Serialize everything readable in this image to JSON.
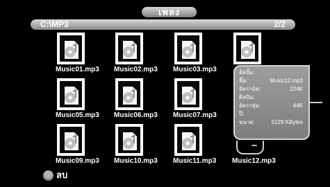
{
  "window": {
    "title": "เพลง"
  },
  "path_bar": {
    "path": "C:\\MP3",
    "page": "2/2"
  },
  "files": [
    "Music01.mp3",
    "Music02.mp3",
    "Music03.mp3",
    "Music05.mp3",
    "Music06.mp3",
    "Music07.mp3",
    "Music09.mp3",
    "Music10.mp3",
    "Music11.mp3",
    "Music12.mp3"
  ],
  "info_panel": {
    "fields": [
      {
        "label": "อัลบั้ม:",
        "value": ""
      },
      {
        "label": "ชื่อ:",
        "value": "Music12.mp3"
      },
      {
        "label": "อัตราบิต:",
        "value": "224K"
      },
      {
        "label": "ศิลปิน:",
        "value": ""
      },
      {
        "label": "อัตราสุ่ม:",
        "value": "44K"
      },
      {
        "label": "ปี:",
        "value": ""
      },
      {
        "label": "ขนาด:",
        "value": "5129 KBytes"
      }
    ]
  },
  "footer": {
    "delete_label": "ลบ"
  },
  "icons": {
    "music_file_icon": "music-file-icon"
  }
}
